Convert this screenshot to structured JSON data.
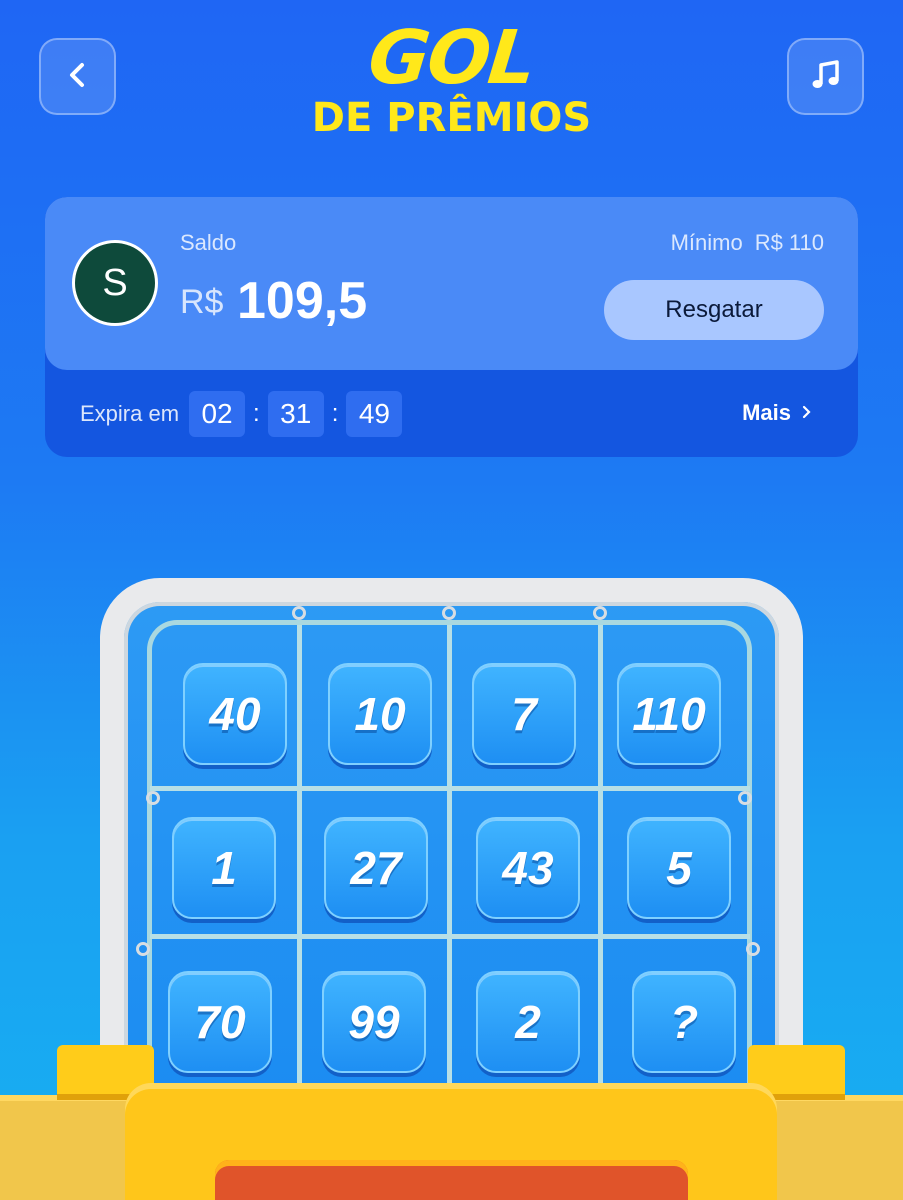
{
  "header": {
    "back_icon": "chevron-left-icon",
    "music_icon": "music-note-icon",
    "logo_line1": "GOL",
    "logo_line2": "DE PRÊMIOS"
  },
  "balance_card": {
    "avatar_letter": "S",
    "saldo_label": "Saldo",
    "currency": "R$",
    "amount": "109,5",
    "minimum_label": "Mínimo",
    "minimum_value": "R$ 110",
    "redeem_button": "Resgatar",
    "expires_label": "Expira em",
    "timer": {
      "hours": "02",
      "minutes": "31",
      "seconds": "49",
      "separator": ":"
    },
    "more_link": "Mais"
  },
  "grid": {
    "tiles": [
      "40",
      "10",
      "7",
      "110",
      "1",
      "27",
      "43",
      "5",
      "70",
      "99",
      "2",
      "?"
    ]
  },
  "colors": {
    "background_top": "#1f66f4",
    "logo_yellow": "#ffe81a",
    "card_top": "#4a8af7",
    "card_bottom": "#1456e0",
    "tile": "#1e8ff3"
  }
}
